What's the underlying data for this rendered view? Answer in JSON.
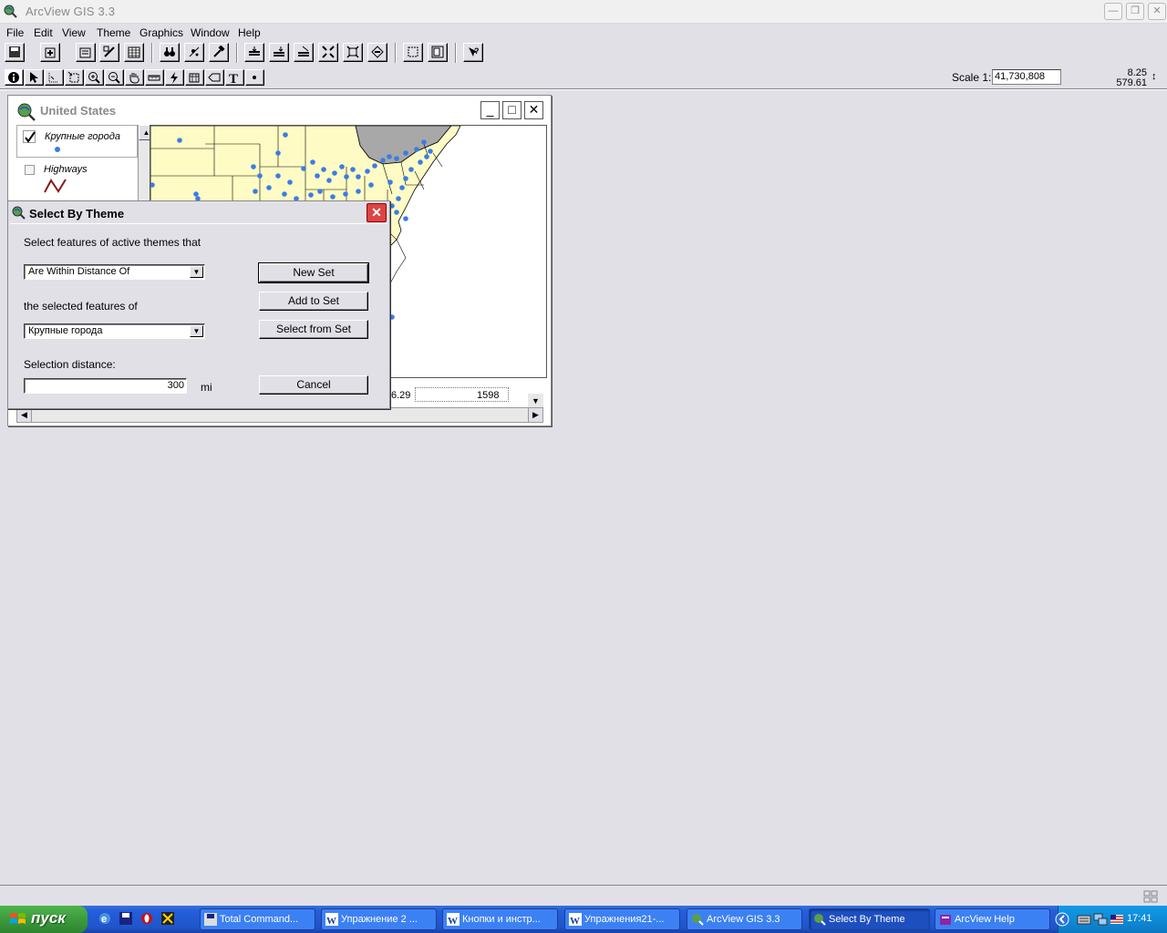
{
  "app": {
    "title": "ArcView GIS 3.3",
    "window_buttons": [
      "minimize",
      "restore",
      "close"
    ]
  },
  "menu": [
    "File",
    "Edit",
    "View",
    "Theme",
    "Graphics",
    "Window",
    "Help"
  ],
  "scale": {
    "label": "Scale 1:",
    "value": "41,730,808"
  },
  "coords": {
    "x": "8.25",
    "y": "579.61"
  },
  "view_window": {
    "title": "United States",
    "legend": [
      {
        "name": "Крупные города",
        "checked": true,
        "symbol": "blue-dot"
      },
      {
        "name": "Highways",
        "checked": false,
        "symbol": "red-line"
      }
    ],
    "table_fragment": {
      "col1": "6.29",
      "col2": "1598"
    }
  },
  "dialog": {
    "title": "Select By Theme",
    "prompt": "Select features of active themes that",
    "relation_value": "Are Within Distance Of",
    "selected_of_label": "the selected features of",
    "theme_value": "Крупные города",
    "distance_label": "Selection distance:",
    "distance_value": "300",
    "distance_unit": "mi",
    "buttons": {
      "new_set": "New Set",
      "add_to_set": "Add to Set",
      "select_from_set": "Select from Set",
      "cancel": "Cancel"
    }
  },
  "taskbar": {
    "start": "пуск",
    "tasks": [
      {
        "label": "Total Command...",
        "icon": "floppy-icon",
        "active": false
      },
      {
        "label": "Упражнение 2 ...",
        "icon": "word-icon",
        "active": false
      },
      {
        "label": "Кнопки и инстр...",
        "icon": "word-icon",
        "active": false
      },
      {
        "label": "Упражнения21-...",
        "icon": "word-icon",
        "active": false
      },
      {
        "label": "ArcView GIS 3.3",
        "icon": "arcview-icon",
        "active": false
      },
      {
        "label": "Select By Theme",
        "icon": "arcview-icon",
        "active": true
      },
      {
        "label": "ArcView Help",
        "icon": "help-book-icon",
        "active": false
      }
    ],
    "clock": "17:41"
  },
  "colors": {
    "desktop": "#e1e0e7",
    "map_land": "#fffbc4",
    "map_neighbor": "#a8a8a8",
    "city_dot": "#3a7de3",
    "taskbar": "#245edb",
    "start": "#3c9b3c"
  }
}
